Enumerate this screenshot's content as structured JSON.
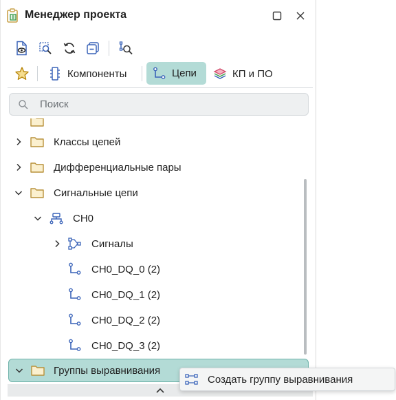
{
  "window": {
    "title": "Менеджер проекта"
  },
  "toolbar2": {
    "tabs": [
      {
        "label": "Компоненты"
      },
      {
        "label": "Цепи"
      },
      {
        "label": "КП и ПО"
      }
    ],
    "active_tab": "Цепи"
  },
  "search": {
    "placeholder": "Поиск",
    "value": ""
  },
  "tree": {
    "items": [
      {
        "label": "Классы цепей"
      },
      {
        "label": "Дифференциальные пары"
      },
      {
        "label": "Сигнальные цепи"
      },
      {
        "label": "CH0"
      },
      {
        "label": "Сигналы"
      },
      {
        "label": "CH0_DQ_0 (2)"
      },
      {
        "label": "CH0_DQ_1 (2)"
      },
      {
        "label": "CH0_DQ_2 (2)"
      },
      {
        "label": "CH0_DQ_3 (2)"
      },
      {
        "label": "Группы выравнивания"
      }
    ],
    "selected": "Группы выравнивания"
  },
  "context_menu": {
    "items": [
      {
        "label": "Создать группу выравнивания"
      }
    ]
  },
  "colors": {
    "accent_bg": "#b3dbd6",
    "accent_border": "#6fb3aa",
    "icon_blue": "#3a63b8",
    "folder": "#c9a24a",
    "star": "#d9a521"
  }
}
